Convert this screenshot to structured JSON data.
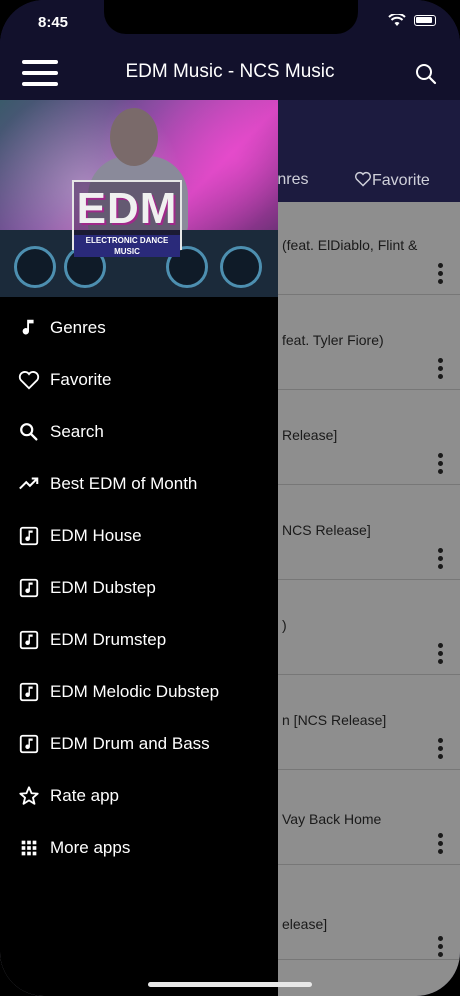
{
  "status_bar": {
    "time": "8:45"
  },
  "app_bar": {
    "title": "EDM Music - NCS Music"
  },
  "tabs": [
    {
      "label": "Genres"
    },
    {
      "label": "Favorite"
    }
  ],
  "list_rows": [
    "(feat. ElDiablo, Flint &",
    "feat. Tyler Fiore)",
    "Release]",
    "NCS Release]",
    ")",
    "n [NCS Release]",
    "Vay Back Home",
    "elease]"
  ],
  "banner": {
    "logo_text": "EDM",
    "logo_subtitle": "ELECTRONIC DANCE MUSIC"
  },
  "drawer_menu": [
    {
      "label": "Genres",
      "icon": "music-note-icon"
    },
    {
      "label": "Favorite",
      "icon": "heart-icon"
    },
    {
      "label": "Search",
      "icon": "search-icon"
    },
    {
      "label": "Best EDM of Month",
      "icon": "trending-up-icon"
    },
    {
      "label": "EDM House",
      "icon": "music-box-icon"
    },
    {
      "label": "EDM Dubstep",
      "icon": "music-box-icon"
    },
    {
      "label": "EDM Drumstep",
      "icon": "music-box-icon"
    },
    {
      "label": "EDM Melodic Dubstep",
      "icon": "music-box-icon"
    },
    {
      "label": "EDM Drum and Bass",
      "icon": "music-box-icon"
    },
    {
      "label": "Rate app",
      "icon": "star-icon"
    },
    {
      "label": "More apps",
      "icon": "grid-icon"
    }
  ]
}
